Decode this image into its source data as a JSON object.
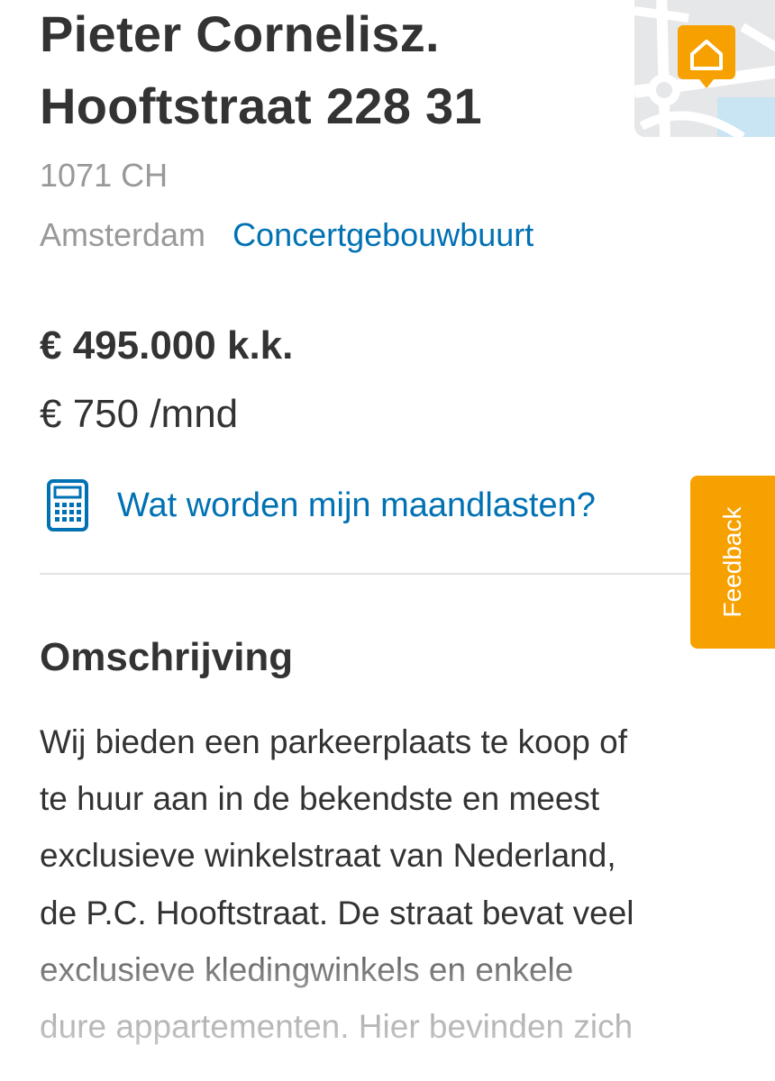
{
  "listing": {
    "title_line1": "Pieter Cornelisz.",
    "title_line2": "Hooftstraat 228 31",
    "postal_code": "1071 CH",
    "city": "Amsterdam",
    "neighbourhood": "Concertgebouwbuurt",
    "price": "€ 495.000 k.k.",
    "rent": "€ 750 /mnd"
  },
  "monthly_costs": {
    "label": "Wat worden mijn maandlasten?",
    "icon": "calculator-icon"
  },
  "map": {
    "icon": "house-marker-icon"
  },
  "description": {
    "heading": "Omschrijving",
    "lines": [
      "Wij bieden een parkeerplaats te koop of",
      "te huur aan in de bekendste en meest",
      "exclusieve winkelstraat van Nederland,",
      "de P.C. Hooftstraat. De straat bevat veel",
      "exclusieve kledingwinkels en enkele",
      "dure appartementen. Hier bevinden zich"
    ]
  },
  "feedback": {
    "label": "Feedback"
  },
  "colors": {
    "link": "#0071b3",
    "accent": "#f7a100",
    "muted": "#999999",
    "text": "#333333"
  }
}
